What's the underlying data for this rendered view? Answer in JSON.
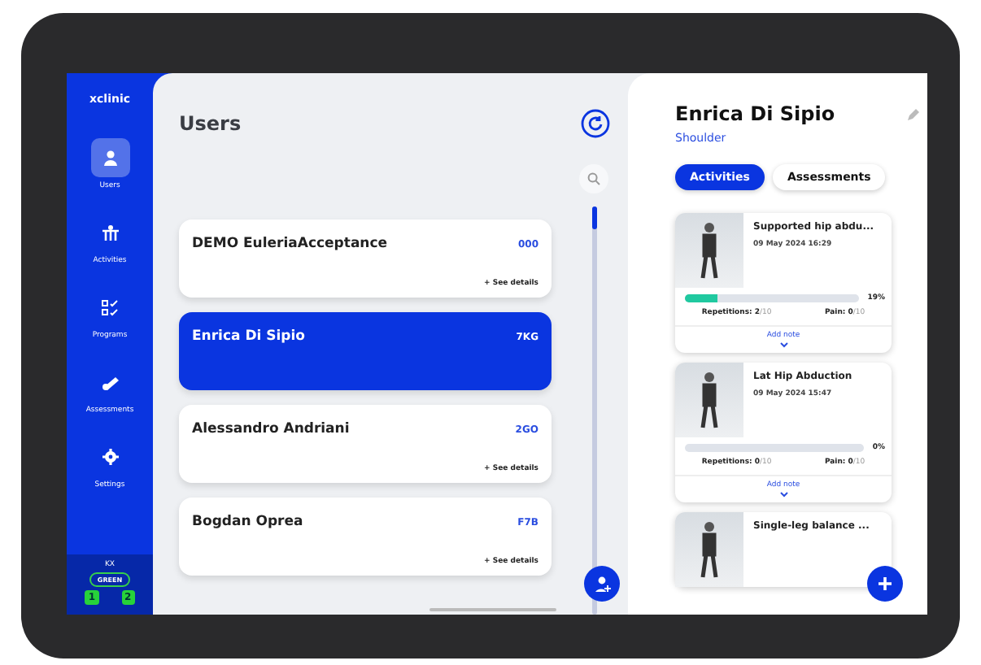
{
  "sidebar": {
    "logo": "xclinic",
    "items": [
      {
        "label": "Users",
        "selected": true
      },
      {
        "label": "Activities",
        "selected": false
      },
      {
        "label": "Programs",
        "selected": false
      },
      {
        "label": "Assessments",
        "selected": false
      },
      {
        "label": "Settings",
        "selected": false
      }
    ],
    "footer": {
      "code": "KX",
      "status": "GREEN",
      "slots": [
        "1",
        "2"
      ]
    }
  },
  "users": {
    "title": "Users",
    "rows": [
      {
        "name": "DEMO EuleriaAcceptance",
        "code": "000",
        "details": "+ See details",
        "selected": false
      },
      {
        "name": "Enrica Di Sipio",
        "code": "7KG",
        "selected": true
      },
      {
        "name": "Alessandro Andriani",
        "code": "2GO",
        "details": "+ See details",
        "selected": false
      },
      {
        "name": "Bogdan Oprea",
        "code": "F7B",
        "details": "+ See details",
        "selected": false
      }
    ]
  },
  "detail": {
    "name": "Enrica Di Sipio",
    "area": "Shoulder",
    "tabs": [
      {
        "label": "Activities",
        "selected": true
      },
      {
        "label": "Assessments",
        "selected": false
      }
    ],
    "activities": [
      {
        "title": "Supported hip abdu...",
        "date": "09 May 2024 16:29",
        "level": 0.19,
        "percent": "19%",
        "reps_label": "Repetitions: 2",
        "reps_max": "/10",
        "pain_label": "Pain: 0",
        "pain_max": "/10",
        "note": "Add note"
      },
      {
        "title": "Lat Hip Abduction",
        "date": "09 May 2024 15:47",
        "level": 0,
        "percent": "0%",
        "reps_label": "Repetitions: 0",
        "reps_max": "/10",
        "pain_label": "Pain: 0",
        "pain_max": "/10",
        "note": "Add note"
      },
      {
        "title": "Single-leg balance ..."
      }
    ]
  }
}
